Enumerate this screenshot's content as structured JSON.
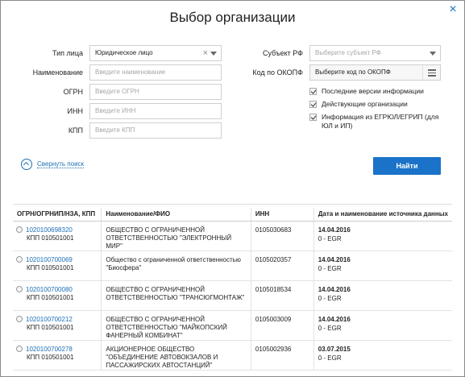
{
  "dialog": {
    "title": "Выбор организации",
    "close_label": "×"
  },
  "form": {
    "type_label": "Тип лица",
    "type_value": "Юридическое лицо",
    "type_clear": "×",
    "name_label": "Наименование",
    "name_placeholder": "Введите наименование",
    "ogrn_label": "ОГРН",
    "ogrn_placeholder": "Введите ОГРН",
    "inn_label": "ИНН",
    "inn_placeholder": "Введите ИНН",
    "kpp_label": "КПП",
    "kpp_placeholder": "Введите КПП",
    "subject_label": "Субъект РФ",
    "subject_placeholder": "Выберите субъект РФ",
    "okopf_label": "Код по ОКОПФ",
    "okopf_placeholder": "Выберите код по ОКОПФ",
    "checkboxes": [
      {
        "label": "Последние версии информации",
        "checked": true
      },
      {
        "label": "Действующие организации",
        "checked": true
      },
      {
        "label": "Информация из ЕГРЮЛ/ЕГРИП (для ЮЛ и ИП)",
        "checked": true
      }
    ],
    "collapse_label": "Свернуть поиск",
    "find_label": "Найти"
  },
  "table": {
    "headers": [
      "ОГРН/ОГРНИП/НЗА, КПП",
      "Наименование/ФИО",
      "ИНН",
      "Дата и наименование источника данных"
    ],
    "rows": [
      {
        "ogrn": "1020100698320",
        "kpp": "КПП 010501001",
        "name": "ОБЩЕСТВО С ОГРАНИЧЕННОЙ ОТВЕТСТВЕННОСТЬЮ \"ЭЛЕКТРОННЫЙ МИР\"",
        "inn": "0105030683",
        "date": "14.04.2016",
        "source": "0 - EGR"
      },
      {
        "ogrn": "1020100700069",
        "kpp": "КПП 010501001",
        "name": "Общество с ограниченной ответственностью \"Биосфера\"",
        "inn": "0105020357",
        "date": "14.04.2016",
        "source": "0 - EGR"
      },
      {
        "ogrn": "1020100700080",
        "kpp": "КПП 010501001",
        "name": "ОБЩЕСТВО С ОГРАНИЧЕННОЙ ОТВЕТСТВЕННОСТЬЮ \"ТРАНСЮГМОНТАЖ\"",
        "inn": "0105018534",
        "date": "14.04.2016",
        "source": "0 - EGR"
      },
      {
        "ogrn": "1020100700212",
        "kpp": "КПП 010501001",
        "name": "ОБЩЕСТВО С ОГРАНИЧЕННОЙ ОТВЕТСТВЕННОСТЬЮ \"МАЙКОПСКИЙ ФАНЕРНЫЙ КОМБИНАТ\"",
        "inn": "0105003009",
        "date": "14.04.2016",
        "source": "0 - EGR"
      },
      {
        "ogrn": "1020100700278",
        "kpp": "КПП 010501001",
        "name": "АКЦИОНЕРНОЕ ОБЩЕСТВО \"ОБЪЕДИНЕНИЕ АВТОВОКЗАЛОВ И ПАССАЖИРСКИХ АВТОСТАНЦИЙ\"",
        "inn": "0105002936",
        "date": "03.07.2015",
        "source": "0 - EGR"
      }
    ]
  }
}
